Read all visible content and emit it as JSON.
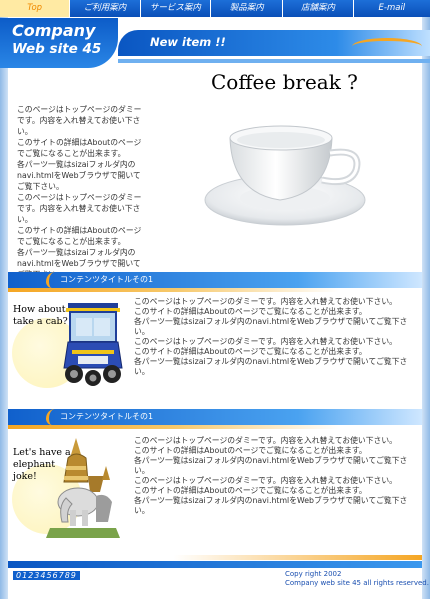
{
  "nav": {
    "items": [
      {
        "label": "Top"
      },
      {
        "label": "ご利用案内"
      },
      {
        "label": "サービス案内"
      },
      {
        "label": "製品案内"
      },
      {
        "label": "店舗案内"
      },
      {
        "label": "E-mail"
      }
    ]
  },
  "brand": {
    "line1": "Company",
    "line2": "Web site 45"
  },
  "header": {
    "new_item": "New item !!"
  },
  "hero": {
    "title": "Coffee break ?",
    "intro": "このページはトップページのダミーです。内容を入れ替えてお使い下さい。\nこのサイトの詳細はAboutのページでご覧になることが出来ます。\n各パーツ一覧はsizaiフォルダ内のnavi.htmlをWebブラウザで開いてご覧下さい。\nこのページはトップページのダミーです。内容を入れ替えてお使い下さい。\nこのサイトの詳細はAboutのページでご覧になることが出来ます。\n各パーツ一覧はsizaiフォルダ内のnavi.htmlをWebブラウザで開いてご覧下さい。"
  },
  "sections": [
    {
      "title": "コンテンツタイトルその1",
      "question": "How about take a cab?",
      "text": "このページはトップページのダミーです。内容を入れ替えてお使い下さい。\nこのサイトの詳細はAboutのページでご覧になることが出来ます。\n各パーツ一覧はsizaiフォルダ内のnavi.htmlをWebブラウザで開いてご覧下さい。\nこのページはトップページのダミーです。内容を入れ替えてお使い下さい。\nこのサイトの詳細はAboutのページでご覧になることが出来ます。\n各パーツ一覧はsizaiフォルダ内のnavi.htmlをWebブラウザで開いてご覧下さい。"
    },
    {
      "title": "コンテンツタイトルその1",
      "question": "Let's have a elephant joke!",
      "text": "このページはトップページのダミーです。内容を入れ替えてお使い下さい。\nこのサイトの詳細はAboutのページでご覧になることが出来ます。\n各パーツ一覧はsizaiフォルダ内のnavi.htmlをWebブラウザで開いてご覧下さい。\nこのページはトップページのダミーです。内容を入れ替えてお使い下さい。\nこのサイトの詳細はAboutのページでご覧になることが出来ます。\n各パーツ一覧はsizaiフォルダ内のnavi.htmlをWebブラウザで開いてご覧下さい。"
    }
  ],
  "footer": {
    "counter": "0123456789",
    "copyright_line1": "Copy right 2002",
    "copyright_line2": "Company web site 45 all rights reserved."
  },
  "colors": {
    "brand_blue": "#0c5cc8",
    "accent_orange": "#f5a623",
    "nav_top_bg": "#ffeaa3"
  }
}
